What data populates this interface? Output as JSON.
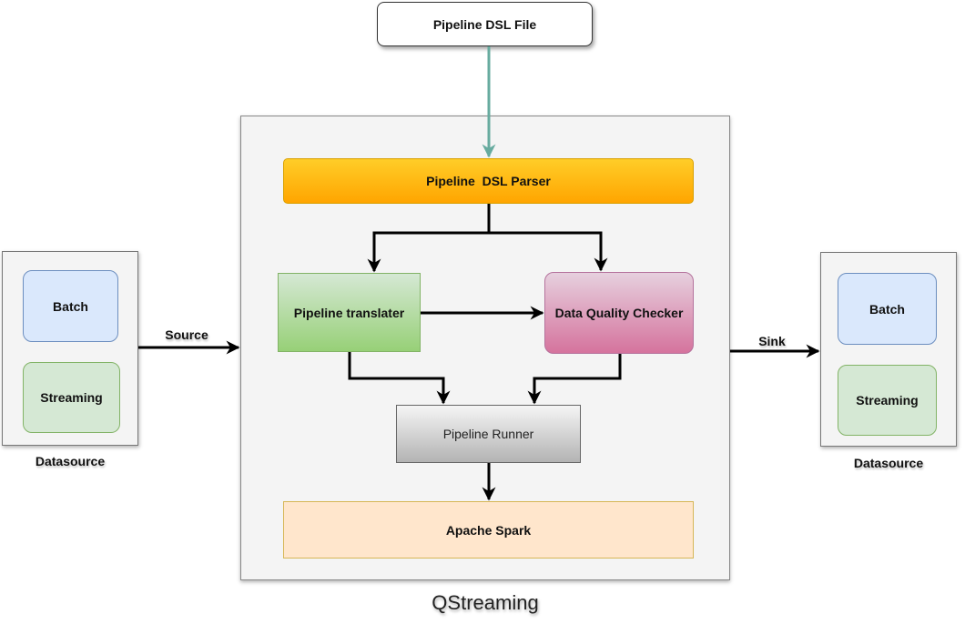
{
  "diagram": {
    "title": "QStreaming",
    "input": {
      "label": "Pipeline DSL File"
    },
    "components": {
      "parser": "Pipeline  DSL Parser",
      "translater": "Pipeline translater",
      "checker": "Data Quality Checker",
      "runner": "Pipeline Runner",
      "engine": "Apache Spark"
    },
    "source_datasource": {
      "label": "Datasource",
      "items": [
        "Batch",
        "Streaming"
      ],
      "edge_label": "Source"
    },
    "sink_datasource": {
      "label": "Datasource",
      "items": [
        "Batch",
        "Streaming"
      ],
      "edge_label": "Sink"
    },
    "colors": {
      "input_edge": "#67ab9f",
      "edge": "#000000",
      "parser_fill": "#ffcd28",
      "translater_fill": "#d5e8d4",
      "checker_fill": "#e6d0de",
      "engine_fill": "#ffe6cc",
      "batch_fill": "#dae8fc",
      "streaming_fill": "#d5e8d4"
    }
  }
}
